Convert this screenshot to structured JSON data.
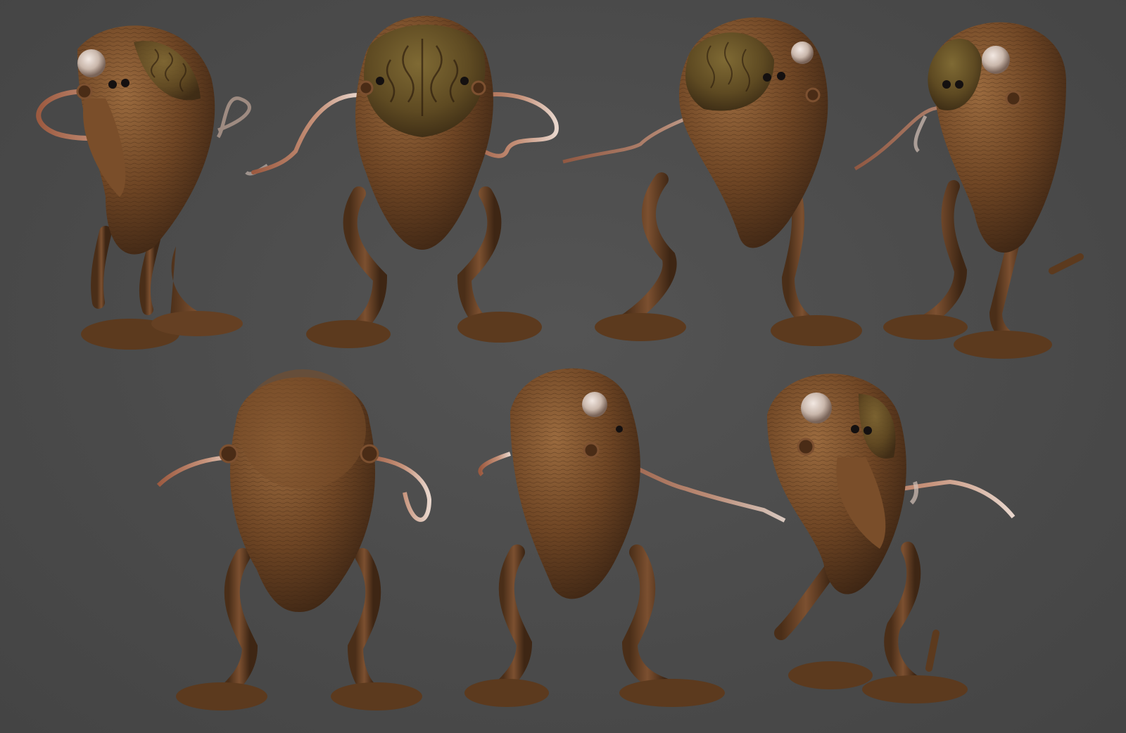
{
  "scene": {
    "background_color": "#4b4b4b",
    "subject": "creature-turnaround",
    "colors": {
      "skin": "#6e4524",
      "skin_highlight": "#9a6a3e",
      "skin_shadow": "#3e2614",
      "head_green": "#6a5a2a",
      "eye": "#c9b7ab",
      "pupil": "#141010",
      "tube": "#b87a5e",
      "tube_tip": "#e8d6cc"
    },
    "views": [
      {
        "id": "front-three-quarter-left",
        "row": 1
      },
      {
        "id": "front",
        "row": 1
      },
      {
        "id": "front-three-quarter-right",
        "row": 1
      },
      {
        "id": "side-right",
        "row": 1
      },
      {
        "id": "back",
        "row": 2
      },
      {
        "id": "back-three-quarter",
        "row": 2
      },
      {
        "id": "side-left",
        "row": 2
      }
    ]
  }
}
